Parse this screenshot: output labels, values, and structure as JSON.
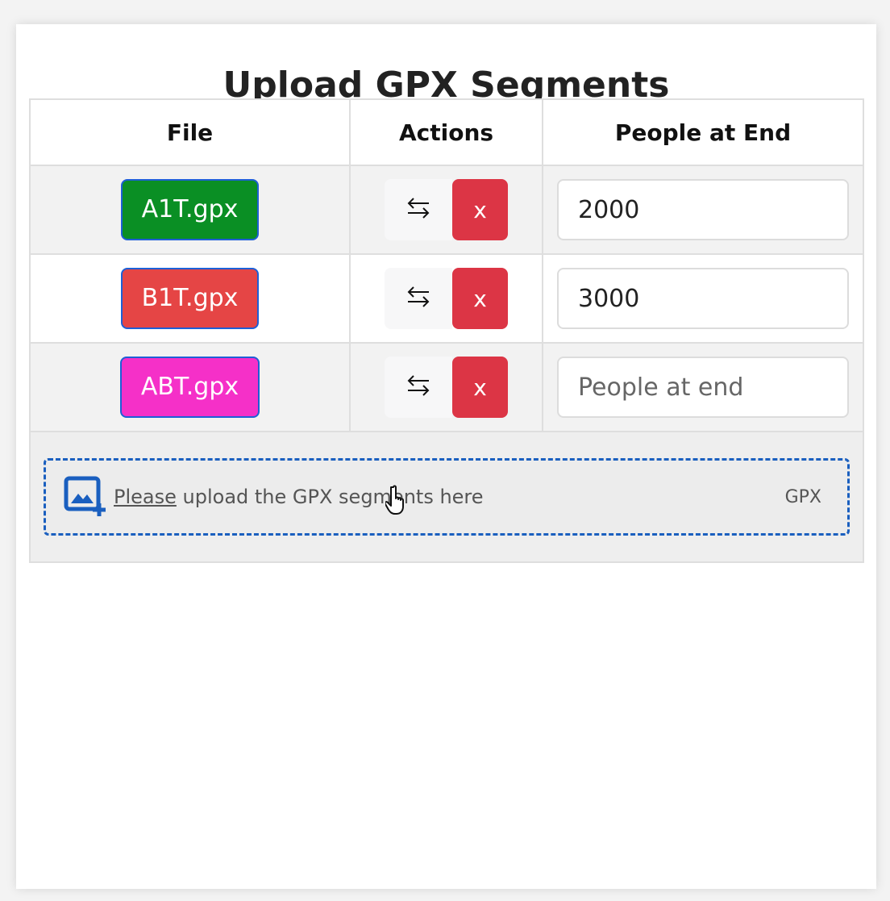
{
  "title": "Upload GPX Segments",
  "table": {
    "headers": [
      "File",
      "Actions",
      "People at End"
    ],
    "rows": [
      {
        "file": "A1T.gpx",
        "file_color": "#0a8f24",
        "swap_icon": "swap-arrows-icon",
        "delete_label": "x",
        "people_value": "2000",
        "people_placeholder": "People at end"
      },
      {
        "file": "B1T.gpx",
        "file_color": "#e54545",
        "swap_icon": "swap-arrows-icon",
        "delete_label": "x",
        "people_value": "3000",
        "people_placeholder": "People at end"
      },
      {
        "file": "ABT.gpx",
        "file_color": "#f530c8",
        "swap_icon": "swap-arrows-icon",
        "delete_label": "x",
        "people_value": "",
        "people_placeholder": "People at end"
      }
    ]
  },
  "upload": {
    "link_text": "Please",
    "text": " upload the GPX segments here",
    "extension": "GPX",
    "icon": "add-image-icon"
  },
  "colors": {
    "delete": "#dc3545",
    "accent": "#1a5fbf"
  }
}
